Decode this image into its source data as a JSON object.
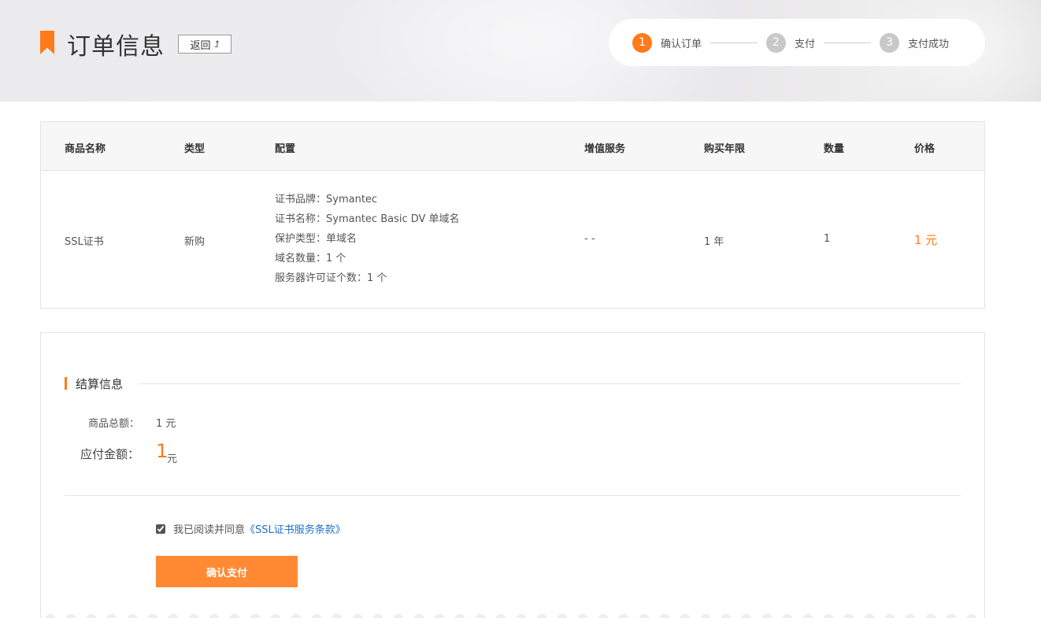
{
  "header": {
    "title": "订单信息",
    "back_label": "返回",
    "back_icon": "return-arrow-icon",
    "steps": [
      {
        "num": "1",
        "label": "确认订单",
        "active": true
      },
      {
        "num": "2",
        "label": "支付",
        "active": false
      },
      {
        "num": "3",
        "label": "支付成功",
        "active": false
      }
    ]
  },
  "colors": {
    "accent": "#ff7a1a",
    "button": "#ff8a33",
    "step_inactive": "#c8c8c8",
    "link": "#1e6fc8"
  },
  "order_table": {
    "columns": [
      "商品名称",
      "类型",
      "配置",
      "增值服务",
      "购买年限",
      "数量",
      "价格"
    ],
    "row": {
      "product": "SSL证书",
      "type": "新购",
      "config": [
        "证书品牌：Symantec",
        "证书名称：Symantec Basic DV 单域名",
        "保护类型：单域名",
        "域名数量：1 个",
        "服务器许可证个数：1 个"
      ],
      "value_added": "- -",
      "years": "1 年",
      "quantity": "1",
      "price": "1 元"
    }
  },
  "settlement": {
    "title": "结算信息",
    "total_label": "商品总额：",
    "total_value": "1 元",
    "payable_label": "应付金额：",
    "payable_amount": "1",
    "payable_unit": "元",
    "agree_text": "我已阅读并同意",
    "agree_checked": true,
    "terms_link": "《SSL证书服务条款》",
    "confirm_label": "确认支付"
  }
}
